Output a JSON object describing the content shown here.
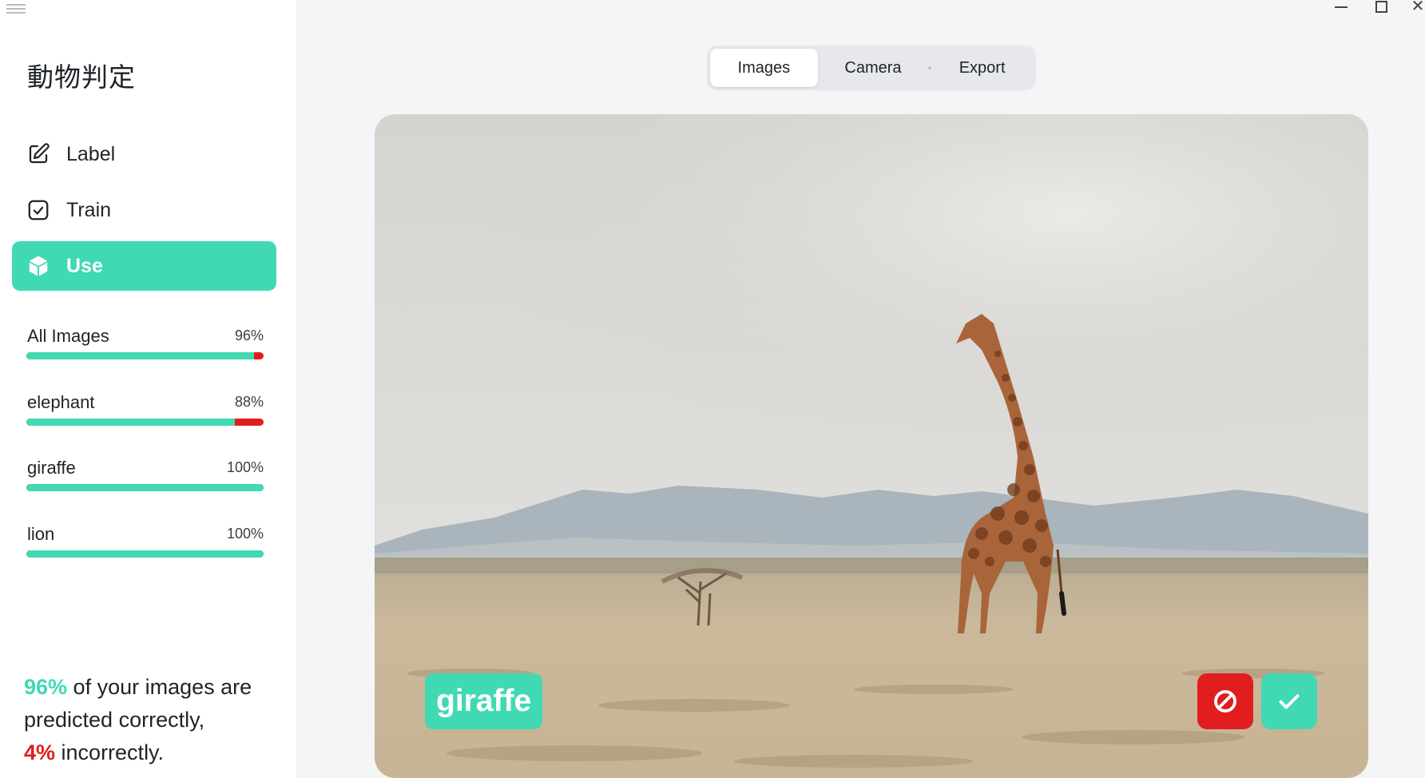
{
  "window": {
    "minimize_label": "minimize",
    "maximize_label": "maximize",
    "close_glyph": "✕"
  },
  "app": {
    "title": "動物判定"
  },
  "nav": {
    "items": [
      {
        "label": "Label",
        "icon": "edit-icon"
      },
      {
        "label": "Train",
        "icon": "checkbox-icon"
      },
      {
        "label": "Use",
        "icon": "cube-icon",
        "active": true
      }
    ]
  },
  "stats": [
    {
      "name": "All Images",
      "pct_text": "96%",
      "accuracy": 0.96
    },
    {
      "name": "elephant",
      "pct_text": "88%",
      "accuracy": 0.88
    },
    {
      "name": "giraffe",
      "pct_text": "100%",
      "accuracy": 1.0
    },
    {
      "name": "lion",
      "pct_text": "100%",
      "accuracy": 1.0
    }
  ],
  "summary": {
    "correct_pct": "96%",
    "correct_text": " of your images are predicted correctly,",
    "incorrect_pct": "4%",
    "incorrect_text": " incorrectly."
  },
  "tabs": [
    {
      "label": "Images",
      "selected": true
    },
    {
      "label": "Camera"
    },
    {
      "label": "Export"
    }
  ],
  "prediction": {
    "label": "giraffe"
  },
  "colors": {
    "accent": "#41d9b4",
    "danger": "#e11d1d",
    "background": "#f4f5f7"
  }
}
